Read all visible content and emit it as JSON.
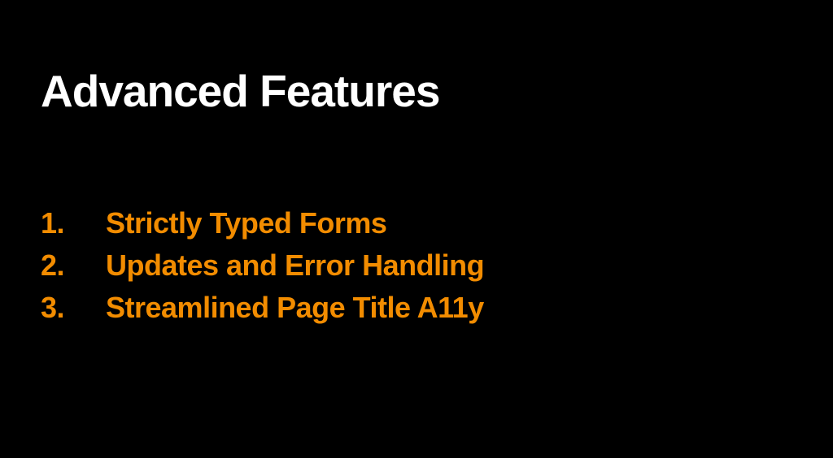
{
  "slide": {
    "title": "Advanced Features",
    "items": [
      "Strictly Typed Forms",
      "Updates and Error Handling",
      "Streamlined Page Title A11y"
    ]
  },
  "colors": {
    "background": "#000000",
    "title": "#ffffff",
    "list": "#f28c00"
  }
}
